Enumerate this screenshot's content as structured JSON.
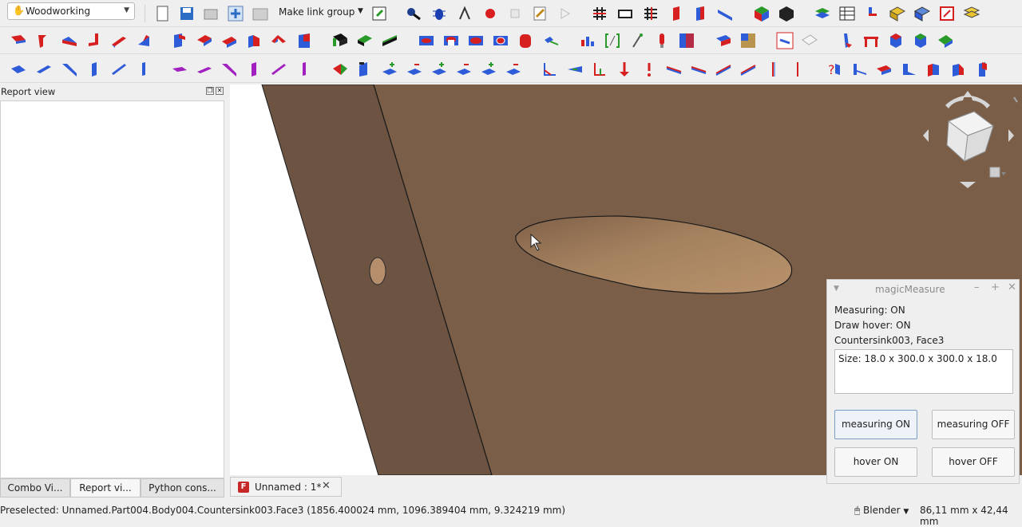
{
  "toolbar": {
    "workbench": "Woodworking",
    "make_link_group": "Make link group"
  },
  "left_panel": {
    "title": "Report view",
    "tabs": [
      "Combo Vi...",
      "Report vi...",
      "Python cons..."
    ]
  },
  "document_tab": {
    "label": "Unnamed : 1*"
  },
  "magic_measure": {
    "title": "magicMeasure",
    "measuring_status": "Measuring: ON",
    "draw_hover_status": "Draw hover: ON",
    "selection": "Countersink003, Face3",
    "size_text": "Size: 18.0 x 300.0 x 300.0 x 18.0",
    "buttons": {
      "measuring_on": "measuring ON",
      "measuring_off": "measuring OFF",
      "hover_on": "hover ON",
      "hover_off": "hover OFF"
    }
  },
  "status_bar": {
    "message": "Preselected: Unnamed.Part004.Body004.Countersink003.Face3 (1856.400024 mm, 1096.389404 mm, 9.324219 mm)",
    "navigation_style": "Blender",
    "dimensions": "86,11 mm x 42,44 mm"
  },
  "colors": {
    "board_light": "#7b5e47",
    "board_dark": "#6d5442",
    "hole": "#b58f6c",
    "accent_blue": "#2e5bd8",
    "accent_red": "#d62020"
  }
}
